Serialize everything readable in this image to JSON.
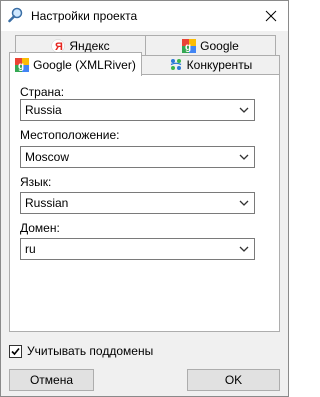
{
  "window": {
    "title": "Настройки проекта"
  },
  "tabs": {
    "back_row": [
      {
        "label": "Яндекс",
        "icon": "yandex-icon"
      },
      {
        "label": "Google",
        "icon": "google-icon"
      }
    ],
    "front_row": [
      {
        "label": "Google (XMLRiver)",
        "icon": "google-icon",
        "active": true
      },
      {
        "label": "Конкуренты",
        "icon": "competitors-icon",
        "active": false
      }
    ]
  },
  "fields": [
    {
      "label": "Страна:",
      "value": "Russia"
    },
    {
      "label": "Местоположение:",
      "value": "Moscow"
    },
    {
      "label": "Язык:",
      "value": "Russian"
    },
    {
      "label": "Домен:",
      "value": "ru"
    }
  ],
  "options": {
    "subdomains_label": "Учитывать поддомены",
    "subdomains_checked": true
  },
  "buttons": {
    "cancel": "Отмена",
    "ok": "OK"
  },
  "colors": {
    "google_red": "#ea4335",
    "google_yellow": "#fbbc05",
    "google_green": "#34a853",
    "google_blue": "#4285f4",
    "yandex_red": "#e52620"
  }
}
